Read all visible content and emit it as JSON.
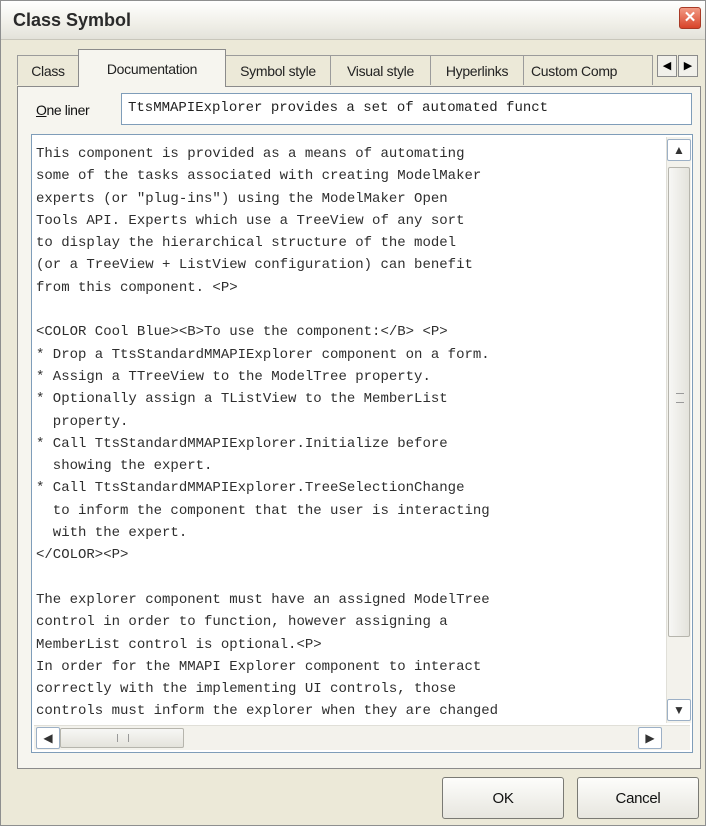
{
  "window": {
    "title": "Class Symbol",
    "close_glyph": "✕"
  },
  "tabs": [
    {
      "label": "Class",
      "active": false
    },
    {
      "label": "Documentation",
      "active": true
    },
    {
      "label": "Symbol style",
      "active": false
    },
    {
      "label": "Visual style",
      "active": false
    },
    {
      "label": "Hyperlinks",
      "active": false
    },
    {
      "label": "Custom Comp",
      "active": false
    }
  ],
  "tab_scroll": {
    "left_glyph": "◀",
    "right_glyph": "▶"
  },
  "one_liner": {
    "label_first": "O",
    "label_rest": "ne liner",
    "value": "TtsMMAPIExplorer provides a set of automated funct"
  },
  "documentation": {
    "lines": [
      "This component is provided as a means of automating",
      "some of the tasks associated with creating ModelMaker",
      "experts (or \"plug-ins\") using the ModelMaker Open",
      "Tools API. Experts which use a TreeView of any sort",
      "to display the hierarchical structure of the model",
      "(or a TreeView + ListView configuration) can benefit",
      "from this component. <P>",
      "",
      "<COLOR Cool Blue><B>To use the component:</B> <P>",
      "* Drop a TtsStandardMMAPIExplorer component on a form.",
      "* Assign a TTreeView to the ModelTree property.",
      "* Optionally assign a TListView to the MemberList",
      "  property.",
      "* Call TtsStandardMMAPIExplorer.Initialize before",
      "  showing the expert.",
      "* Call TtsStandardMMAPIExplorer.TreeSelectionChange",
      "  to inform the component that the user is interacting",
      "  with the expert.",
      "</COLOR><P>",
      "",
      "The explorer component must have an assigned ModelTree",
      "control in order to function, however assigning a",
      "MemberList control is optional.<P>",
      "In order for the MMAPI Explorer component to interact",
      "correctly with the implementing UI controls, those",
      "controls must inform the explorer when they are changed"
    ]
  },
  "scrollbars": {
    "up_glyph": "▲",
    "down_glyph": "▼",
    "left_glyph": "◀",
    "right_glyph": "▶"
  },
  "buttons": {
    "ok": "OK",
    "cancel": "Cancel"
  }
}
